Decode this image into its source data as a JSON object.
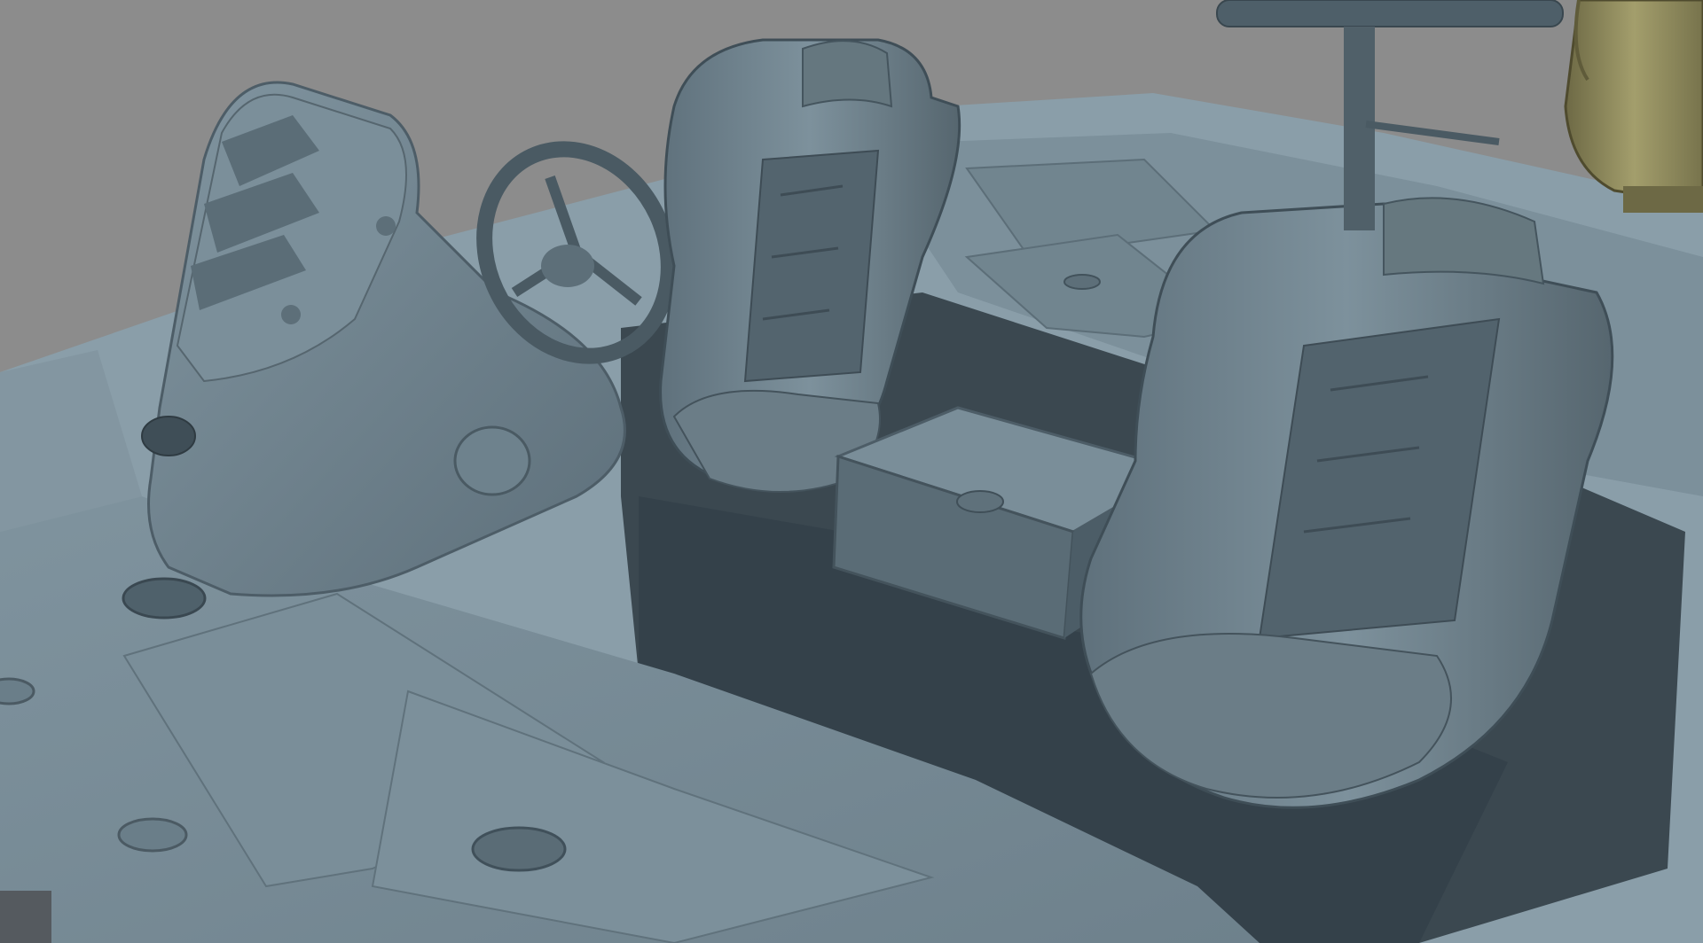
{
  "scene": {
    "subject": "boat-cockpit-clay-render",
    "colors": {
      "background": "#8c8c8c",
      "hull_light": "#8fa3ae",
      "hull_mid": "#768995",
      "hull_dark": "#4f5f69",
      "shadow": "#2b353c",
      "motor": "#8e8a5c",
      "motor_dark": "#5f5b3a"
    },
    "icons": [
      "console-icon",
      "steering-wheel-icon",
      "driver-seat-icon",
      "passenger-seat-icon",
      "storage-box-icon",
      "cup-holder-icon",
      "hatch-handle-icon",
      "outboard-motor-icon",
      "pedestal-seat-icon"
    ]
  }
}
